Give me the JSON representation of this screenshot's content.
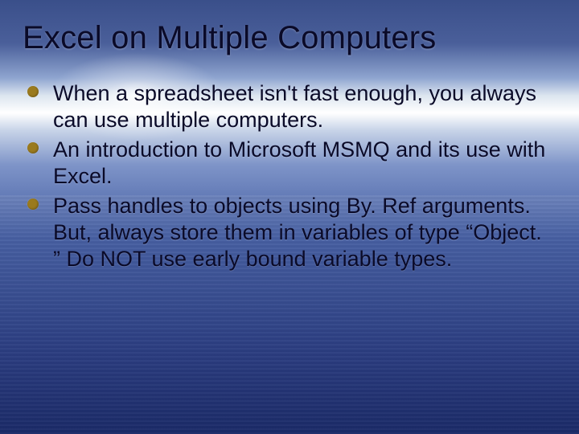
{
  "title": "Excel on Multiple Computers",
  "bullets": [
    "When a spreadsheet isn't fast enough, you always can use multiple computers.",
    "An introduction to Microsoft MSMQ and its use with Excel.",
    "Pass handles to objects using By. Ref arguments.  But, always store them in variables of type “Object. ”  Do NOT use early bound variable types."
  ]
}
